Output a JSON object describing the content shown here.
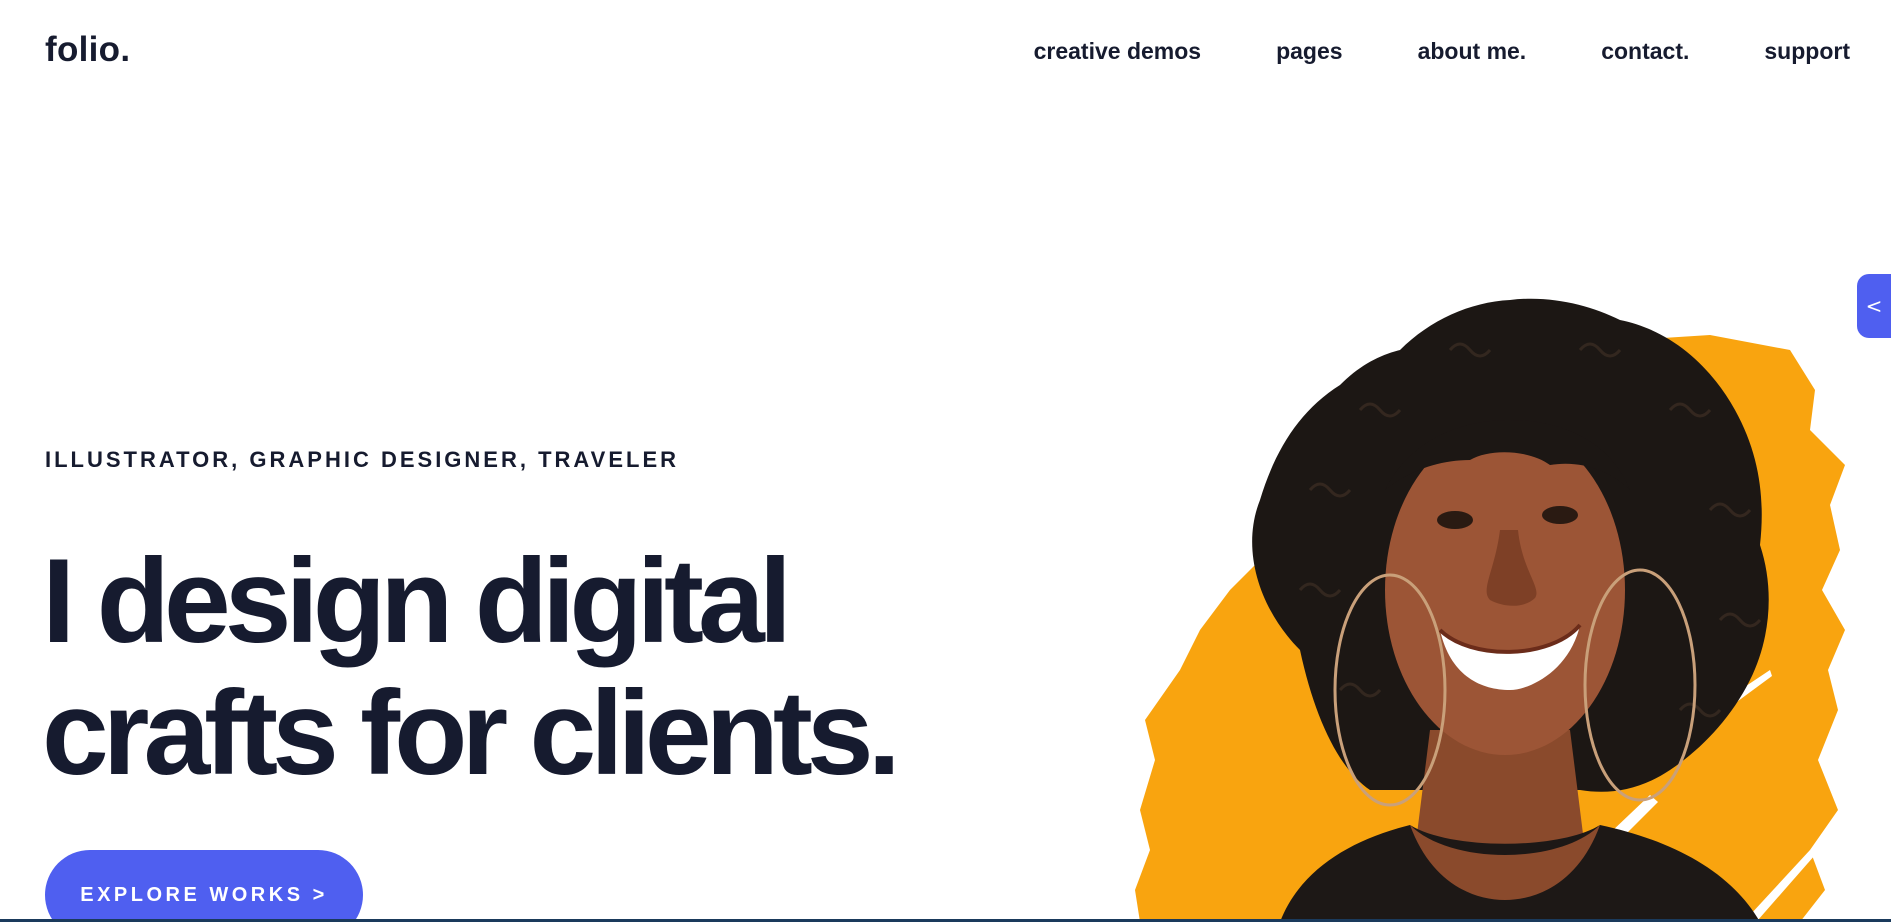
{
  "header": {
    "logo": "folio.",
    "nav": [
      {
        "label": "creative demos"
      },
      {
        "label": "pages"
      },
      {
        "label": "about me."
      },
      {
        "label": "contact."
      },
      {
        "label": "support"
      }
    ]
  },
  "hero": {
    "subtitle": "ILLUSTRATOR, GRAPHIC DESIGNER, TRAVELER",
    "headline_line1": "I design digital",
    "headline_line2": "crafts for clients.",
    "cta_label": "EXPLORE WORKS >"
  },
  "side_tab": {
    "icon": "chevron-left-icon",
    "glyph": "<"
  },
  "colors": {
    "text": "#161b2f",
    "accent": "#4f5ff0",
    "paint": "#f9a40f"
  }
}
